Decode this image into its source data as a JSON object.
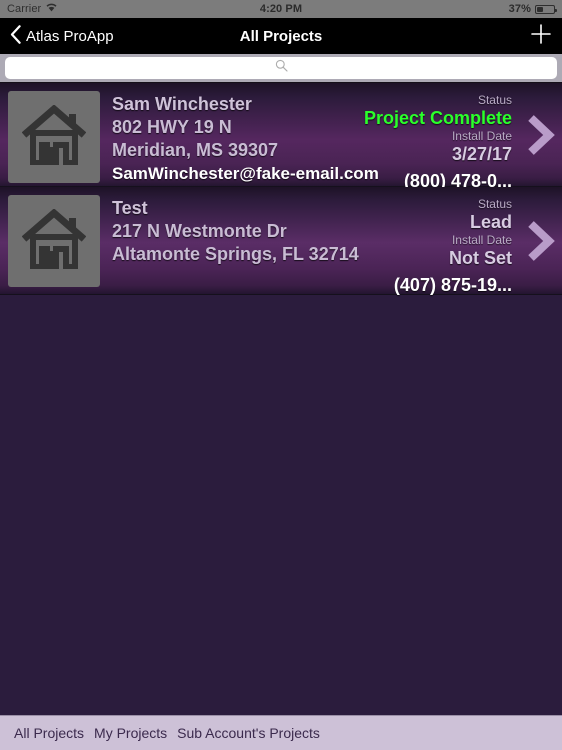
{
  "status_bar": {
    "carrier": "Carrier",
    "wifi_icon": "wifi-icon",
    "time": "4:20 PM",
    "battery_percent": "37%",
    "battery_icon": "battery-icon"
  },
  "nav_bar": {
    "back_icon": "chevron-left-icon",
    "back_label": "Atlas ProApp",
    "title": "All Projects",
    "add_icon": "plus-icon"
  },
  "search": {
    "icon": "search-icon",
    "value": "",
    "placeholder": ""
  },
  "list": {
    "thumb_icon": "house-icon",
    "disclosure_icon": "chevron-right-icon",
    "status_label": "Status",
    "install_date_label": "Install Date",
    "rows": [
      {
        "name": "Sam Winchester",
        "address1": "802 HWY 19 N",
        "address2": "Meridian, MS 39307",
        "email": "SamWinchester@fake-email.com",
        "status": "Project Complete",
        "status_color": "#2bff2b",
        "install_date": "3/27/17",
        "phone": "(800) 478-0..."
      },
      {
        "name": "Test",
        "address1": "217 N Westmonte Dr",
        "address2": "Altamonte Springs, FL 32714",
        "email": "",
        "status": "Lead",
        "status_color": "#d8cce2",
        "install_date": "Not Set",
        "phone": "(407) 875-19..."
      }
    ]
  },
  "tab_bar": {
    "items": [
      {
        "label": "All Projects"
      },
      {
        "label": "My Projects"
      },
      {
        "label": "Sub Account's Projects"
      }
    ]
  },
  "colors": {
    "accent_green": "#2bff2b",
    "row_purple": "#55275f",
    "background": "#2b1c3d",
    "tabbar": "#cdc1d7",
    "chevron": "#b99cc9"
  }
}
